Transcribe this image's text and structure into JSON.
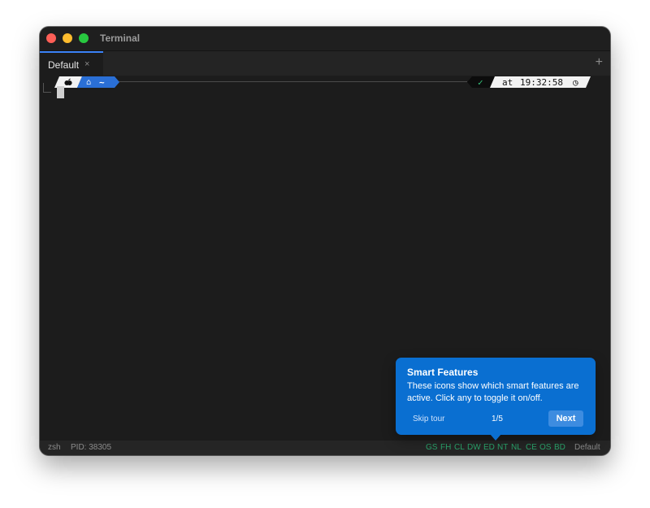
{
  "window": {
    "title": "Terminal"
  },
  "tabs": [
    {
      "label": "Default",
      "close": "×"
    }
  ],
  "tab_add": "+",
  "prompt": {
    "apple_icon": "",
    "home_icon": "⌂",
    "path": "~",
    "check": "✓",
    "time_prefix": "at",
    "time": "19:32:58",
    "clock_icon": "◷"
  },
  "statusbar": {
    "shell": "zsh",
    "pid": "PID: 38305",
    "features": [
      "GS",
      "FH",
      "CL",
      "DW",
      "ED",
      "NT",
      "NL",
      "CE",
      "OS",
      "BD"
    ],
    "profile": "Default"
  },
  "tooltip": {
    "title": "Smart Features",
    "body": "These icons show which smart features are active. Click any to toggle it on/off.",
    "skip": "Skip tour",
    "counter": "1/5",
    "next": "Next"
  },
  "colors": {
    "accent": "#0a6fd1",
    "feature_active": "#2aa56c",
    "prompt_blue": "#2a6fd6"
  }
}
